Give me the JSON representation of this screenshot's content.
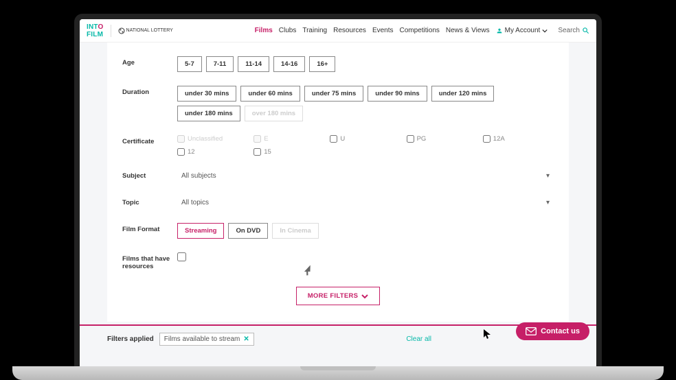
{
  "nav": {
    "items": [
      "Films",
      "Clubs",
      "Training",
      "Resources",
      "Events",
      "Competitions",
      "News & Views"
    ],
    "active": "Films",
    "account": "My Account",
    "search": "Search"
  },
  "logo": {
    "brand": "INTO FILM",
    "partner": "NATIONAL LOTTERY"
  },
  "filters": {
    "age": {
      "label": "Age",
      "options": [
        "5-7",
        "7-11",
        "11-14",
        "14-16",
        "16+"
      ]
    },
    "duration": {
      "label": "Duration",
      "options": [
        "under 30 mins",
        "under 60 mins",
        "under 75 mins",
        "under 90 mins",
        "under 120 mins",
        "under 180 mins"
      ],
      "disabled": [
        "over 180 mins"
      ]
    },
    "certificate": {
      "label": "Certificate",
      "options": [
        "Unclassified",
        "E",
        "U",
        "PG",
        "12A",
        "12",
        "15"
      ],
      "disabled": [
        "Unclassified",
        "E"
      ]
    },
    "subject": {
      "label": "Subject",
      "value": "All subjects"
    },
    "topic": {
      "label": "Topic",
      "value": "All topics"
    },
    "format": {
      "label": "Film Format",
      "options": [
        "Streaming",
        "On DVD"
      ],
      "disabled": [
        "In Cinema"
      ],
      "selected": "Streaming"
    },
    "resources": {
      "label": "Films that have resources"
    }
  },
  "moreFilters": "MORE FILTERS",
  "applied": {
    "label": "Filters applied",
    "tags": [
      "Films available to stream"
    ],
    "clear": "Clear all"
  },
  "contact": "Contact us"
}
